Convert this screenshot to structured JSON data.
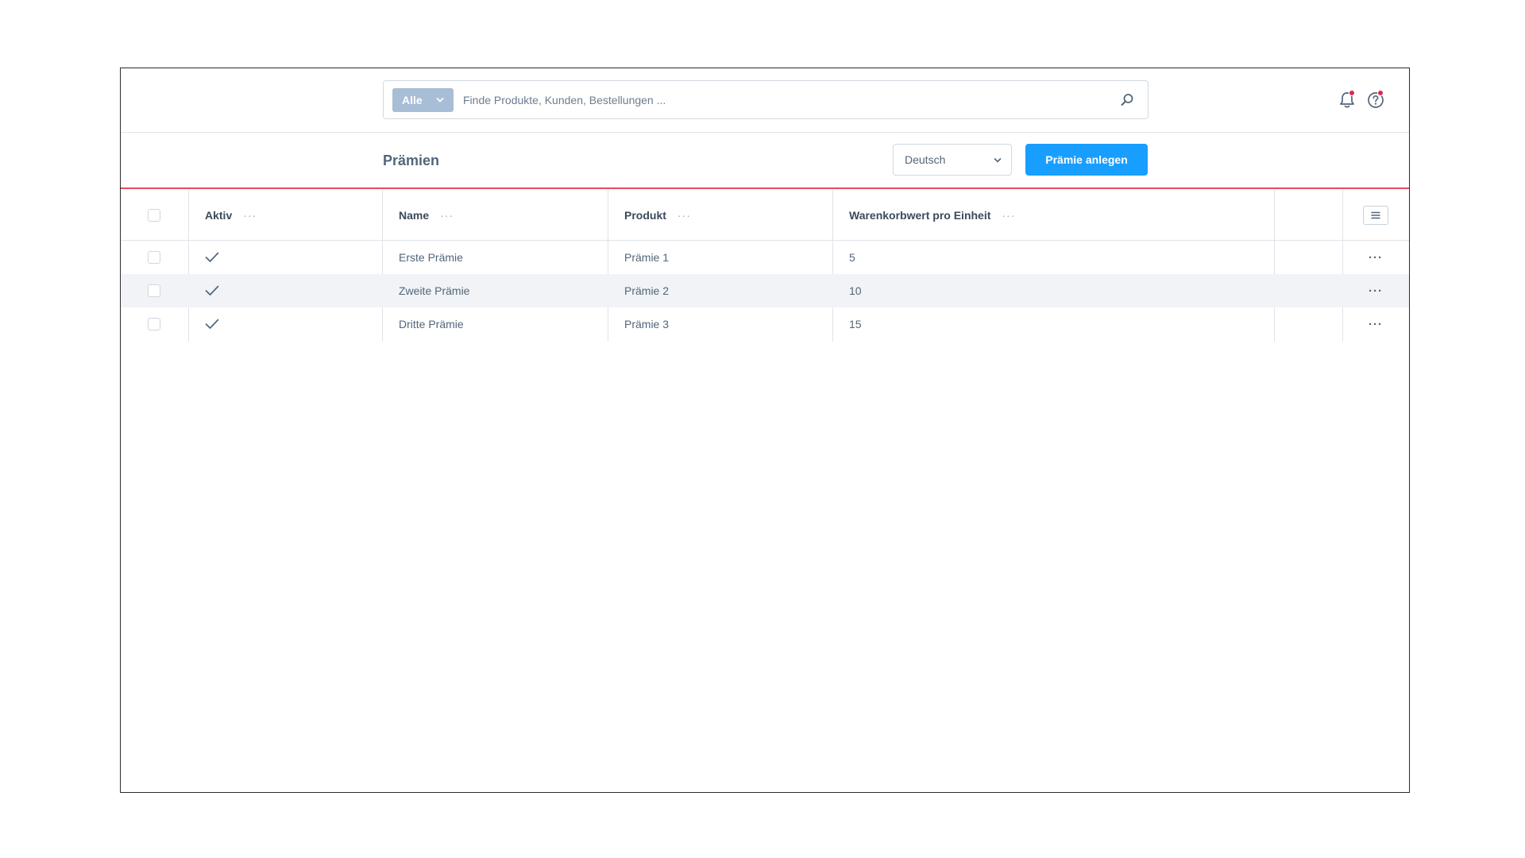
{
  "search": {
    "type_label": "Alle",
    "placeholder": "Finde Produkte, Kunden, Bestellungen ..."
  },
  "header": {
    "title": "Prämien",
    "language": "Deutsch",
    "create_button": "Prämie anlegen"
  },
  "table": {
    "columns": {
      "active": "Aktiv",
      "name": "Name",
      "product": "Produkt",
      "cart_value": "Warenkorbwert pro Einheit"
    },
    "column_menu": "···",
    "row_menu": "···",
    "rows": [
      {
        "active": true,
        "name": "Erste Prämie",
        "product": "Prämie 1",
        "cart_value": "5"
      },
      {
        "active": true,
        "name": "Zweite Prämie",
        "product": "Prämie 2",
        "cart_value": "10"
      },
      {
        "active": true,
        "name": "Dritte Prämie",
        "product": "Prämie 3",
        "cart_value": "15"
      }
    ]
  },
  "colors": {
    "primary": "#189eff",
    "accent_line": "#e34b64",
    "badge": "#de294c",
    "search_type_bg": "#a8bdd6"
  },
  "icons": {
    "search": "search-icon",
    "notifications": "bell-icon",
    "help": "help-icon",
    "settings": "list-settings-icon",
    "check": "check-icon",
    "chevron": "chevron-down-icon"
  }
}
